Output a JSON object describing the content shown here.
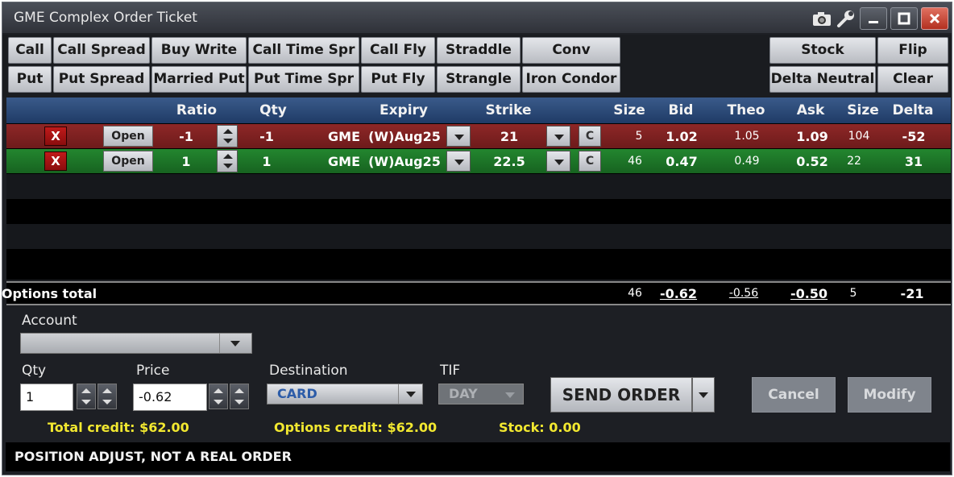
{
  "window": {
    "title": "GME Complex Order Ticket",
    "icons": [
      "camera-icon",
      "wrench-icon",
      "minimize-icon",
      "maximize-icon",
      "close-icon"
    ]
  },
  "strategy_buttons": {
    "row1": [
      "Call",
      "Call Spread",
      "Buy Write",
      "Call Time Spr",
      "Call Fly",
      "Straddle",
      "Conv"
    ],
    "row2": [
      "Put",
      "Put Spread",
      "Married Put",
      "Put Time Spr",
      "Put Fly",
      "Strangle",
      "Iron Condor"
    ],
    "right1": [
      "Stock",
      "Flip"
    ],
    "right2": [
      "Delta Neutral",
      "Clear"
    ]
  },
  "columns": {
    "ratio": "Ratio",
    "qty": "Qty",
    "expiry": "Expiry",
    "strike": "Strike",
    "bid_size": "Size",
    "bid": "Bid",
    "theo": "Theo",
    "ask": "Ask",
    "ask_size": "Size",
    "delta": "Delta"
  },
  "legs": [
    {
      "remove": "X",
      "action": "Open",
      "ratio": "-1",
      "qty": "-1",
      "symbol": "GME",
      "expiry": "(W)Aug25",
      "strike": "21",
      "type": "C",
      "bid_size": "5",
      "bid": "1.02",
      "theo": "1.05",
      "ask": "1.09",
      "ask_size": "104",
      "delta": "-52",
      "row_color": "#8e2727"
    },
    {
      "remove": "X",
      "action": "Open",
      "ratio": "1",
      "qty": "1",
      "symbol": "GME",
      "expiry": "(W)Aug25",
      "strike": "22.5",
      "type": "C",
      "bid_size": "46",
      "bid": "0.47",
      "theo": "0.49",
      "ask": "0.52",
      "ask_size": "22",
      "delta": "31",
      "row_color": "#23862f"
    }
  ],
  "totals": {
    "label": "Options total",
    "bid_size": "46",
    "bid": "-0.62",
    "theo": "-0.56",
    "ask": "-0.50",
    "ask_size": "5",
    "delta": "-21"
  },
  "order_form": {
    "account_label": "Account",
    "account_value": "",
    "qty_label": "Qty",
    "qty_value": "1",
    "price_label": "Price",
    "price_value": "-0.62",
    "destination_label": "Destination",
    "destination_value": "CARD",
    "tif_label": "TIF",
    "tif_value": "DAY",
    "send_label": "SEND ORDER",
    "cancel_label": "Cancel",
    "modify_label": "Modify"
  },
  "summary": {
    "total_credit": "Total credit: $62.00",
    "options_credit": "Options credit: $62.00",
    "stock": "Stock: 0.00"
  },
  "status": "POSITION ADJUST, NOT A REAL ORDER",
  "colors": {
    "accent_yellow": "#f2e830",
    "header_blue": "#2a4a7a",
    "sell_red": "#8e2727",
    "buy_green": "#23862f"
  }
}
